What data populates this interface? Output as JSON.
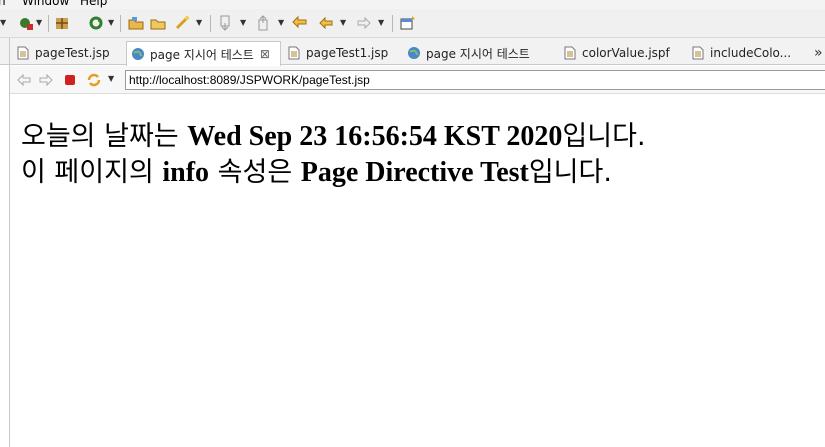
{
  "menu": {
    "items": [
      "n",
      "Window",
      "Help"
    ]
  },
  "toolbar": {
    "icons": [
      "run-icon",
      "debug-icon",
      "build-icon",
      "refresh-icon",
      "open-folder-icon",
      "folder-icon",
      "wand-icon",
      "down-nav-icon",
      "up-nav-icon",
      "back-history-icon",
      "back-icon",
      "forward-icon",
      "new-window-icon"
    ]
  },
  "tabs": [
    {
      "label": "pageTest.jsp",
      "type": "file"
    },
    {
      "label": "page 지시어 테스트",
      "type": "browser",
      "close": "⊠"
    },
    {
      "label": "pageTest1.jsp",
      "type": "file"
    },
    {
      "label": "page 지시어 테스트",
      "type": "browser"
    },
    {
      "label": "colorValue.jspf",
      "type": "file"
    },
    {
      "label": "includeColo...",
      "type": "file"
    }
  ],
  "browser": {
    "url": "http://localhost:8089/JSPWORK/pageTest.jsp"
  },
  "page": {
    "line1": {
      "pre": "오늘의 날짜는 ",
      "date": "Wed Sep 23 16:56:54 KST 2020",
      "post": "입니다."
    },
    "line2": {
      "pre": "이 페이지의 ",
      "info_word": "info",
      "mid": " 속성은 ",
      "value": "Page Directive Test",
      "post": "입니다."
    }
  },
  "colors": {
    "accent_red": "#d22020",
    "toolbar_bg": "#f0f0f0",
    "tab_bg": "#f2f2f2"
  }
}
